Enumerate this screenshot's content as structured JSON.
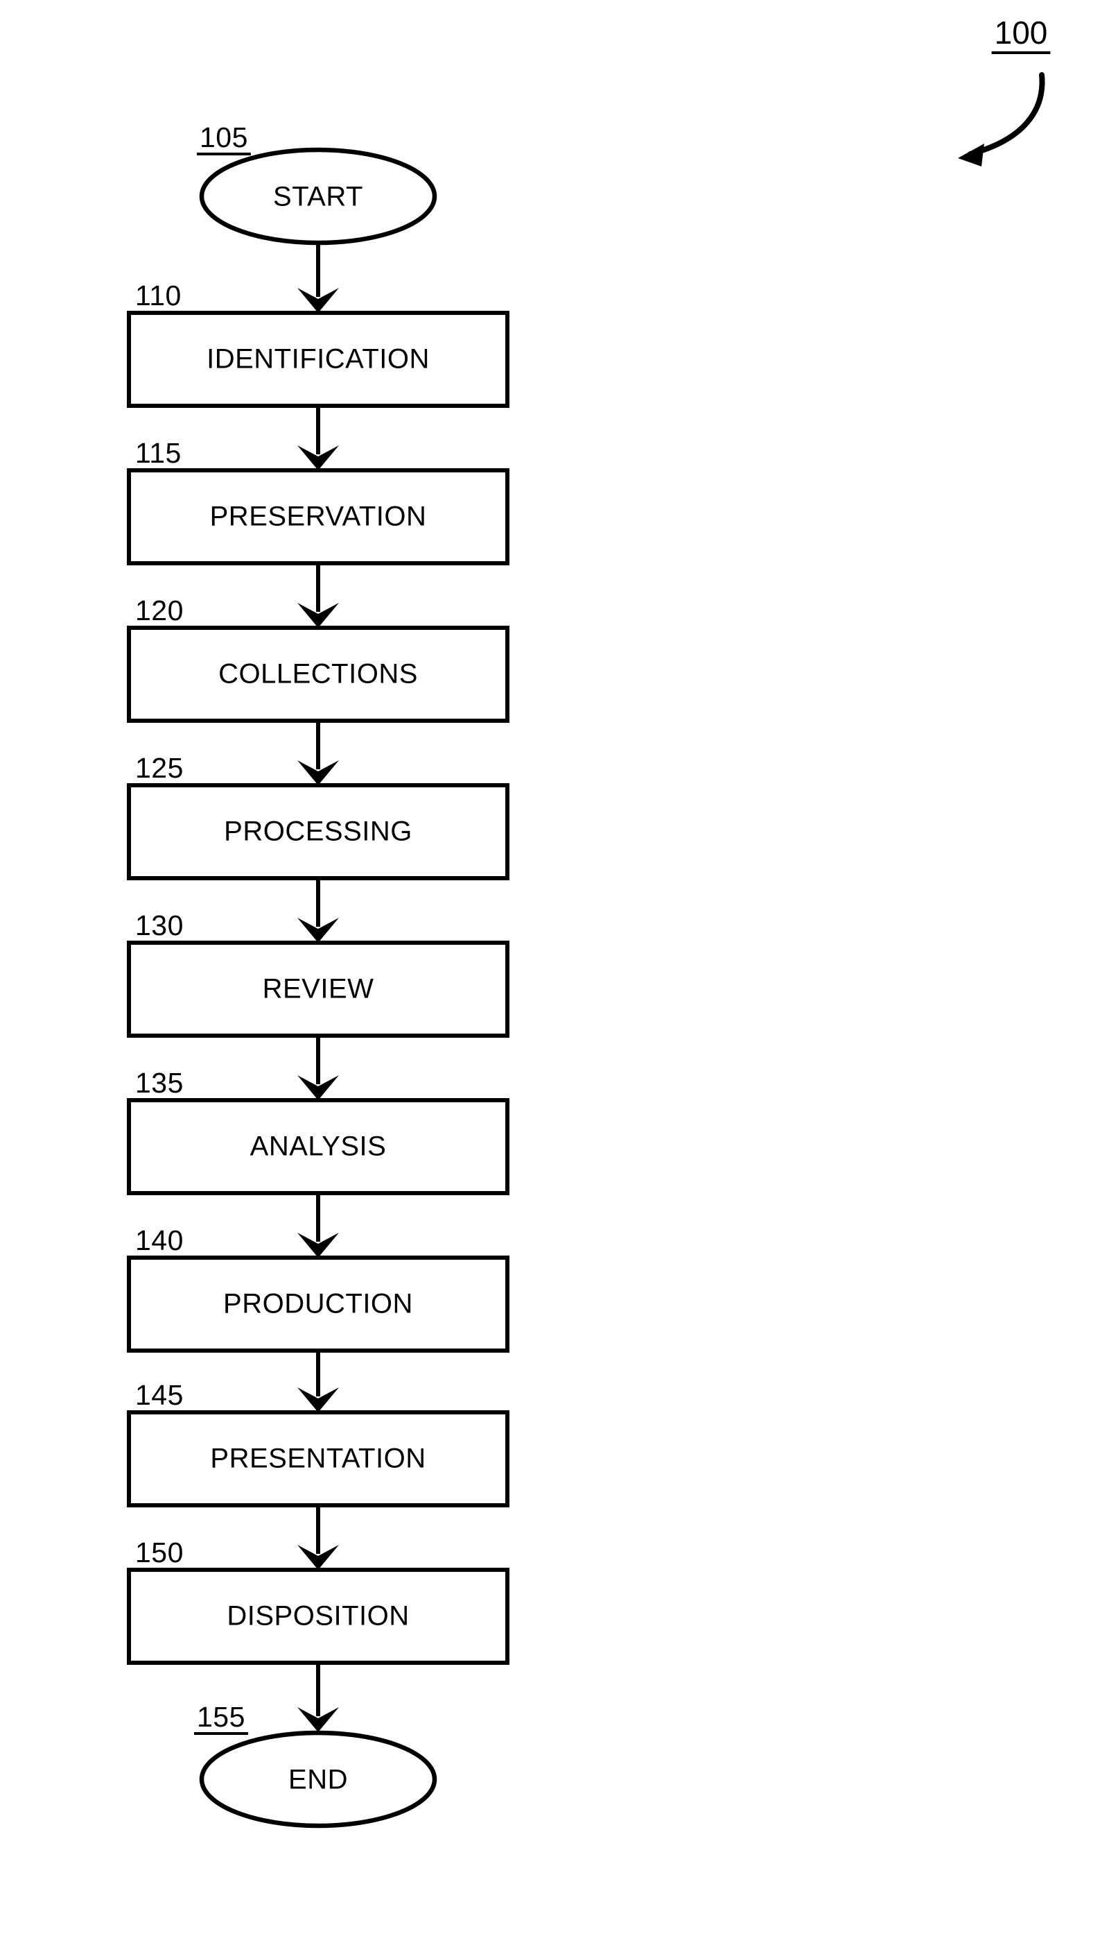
{
  "figure": {
    "reference_numeral": "100",
    "pointer_icon": "curved-arrow-icon",
    "background_color": "#ffffff",
    "line_color": "#000000"
  },
  "flowchart": {
    "title": "100",
    "nodes": [
      {
        "ref": "105",
        "label": "START",
        "shape": "ellipse"
      },
      {
        "ref": "110",
        "label": "IDENTIFICATION",
        "shape": "rectangle"
      },
      {
        "ref": "115",
        "label": "PRESERVATION",
        "shape": "rectangle"
      },
      {
        "ref": "120",
        "label": "COLLECTIONS",
        "shape": "rectangle"
      },
      {
        "ref": "125",
        "label": "PROCESSING",
        "shape": "rectangle"
      },
      {
        "ref": "130",
        "label": "REVIEW",
        "shape": "rectangle"
      },
      {
        "ref": "135",
        "label": "ANALYSIS",
        "shape": "rectangle"
      },
      {
        "ref": "140",
        "label": "PRODUCTION",
        "shape": "rectangle"
      },
      {
        "ref": "145",
        "label": "PRESENTATION",
        "shape": "rectangle"
      },
      {
        "ref": "150",
        "label": "DISPOSITION",
        "shape": "rectangle"
      },
      {
        "ref": "155",
        "label": "END",
        "shape": "ellipse"
      }
    ],
    "edges": [
      {
        "from": "105",
        "to": "110",
        "arrow": "down"
      },
      {
        "from": "110",
        "to": "115",
        "arrow": "down"
      },
      {
        "from": "115",
        "to": "120",
        "arrow": "down"
      },
      {
        "from": "120",
        "to": "125",
        "arrow": "down"
      },
      {
        "from": "125",
        "to": "130",
        "arrow": "down"
      },
      {
        "from": "130",
        "to": "135",
        "arrow": "down"
      },
      {
        "from": "135",
        "to": "140",
        "arrow": "down"
      },
      {
        "from": "140",
        "to": "145",
        "arrow": "down"
      },
      {
        "from": "145",
        "to": "150",
        "arrow": "down"
      },
      {
        "from": "150",
        "to": "155",
        "arrow": "down"
      }
    ]
  }
}
